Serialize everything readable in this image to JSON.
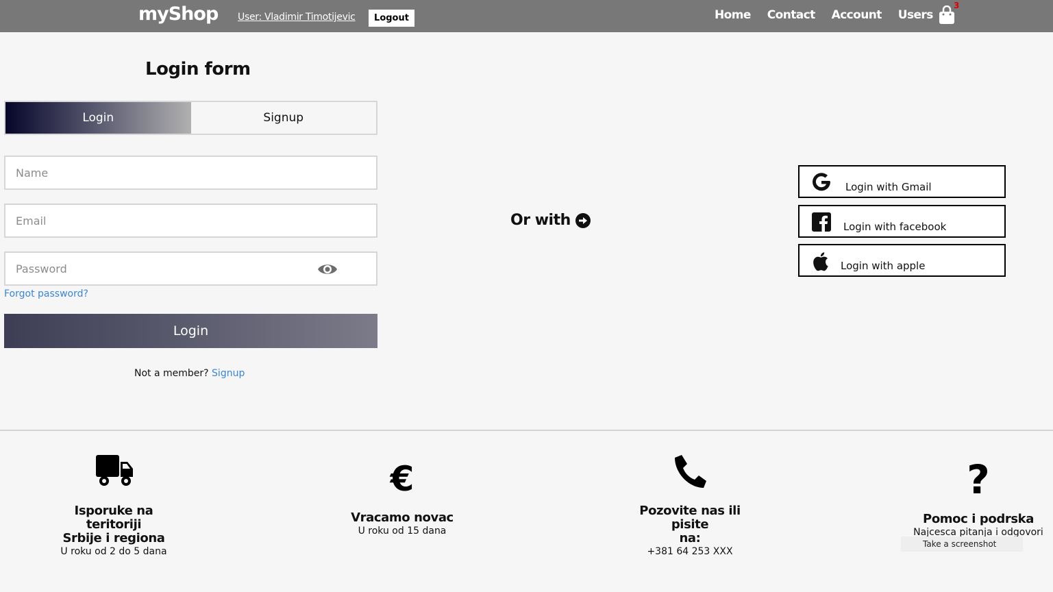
{
  "header": {
    "brand": "myShop",
    "user_link": "User: Vladimir Timotijevic",
    "logout_label": "Logout",
    "nav": [
      "Home",
      "Contact",
      "Account",
      "Users"
    ],
    "cart_count": "3",
    "cart_icon": "shopping-bag-icon"
  },
  "login_form": {
    "title": "Login form",
    "tabs": {
      "login": "Login",
      "signup": "Signup"
    },
    "name_placeholder": "Name",
    "email_placeholder": "Email",
    "password_placeholder": "Password",
    "password_toggle_icon": "eye-icon",
    "forgot": "Forgot password?",
    "submit_label": "Login",
    "not_member": "Not a member?",
    "signup_link": "Signup"
  },
  "or_with": "Or with",
  "social": {
    "gmail": "Login with Gmail",
    "facebook": "Login with facebook",
    "apple": "Login with apple"
  },
  "footer": {
    "features": [
      {
        "icon": "truck-icon",
        "title_line1": "Isporuke na teritoriji",
        "title_line2": "Srbije i regiona",
        "subtitle": "U roku od 2 do 5 dana"
      },
      {
        "icon": "euro-icon",
        "title_line1": "Vracamo novac",
        "title_line2": "",
        "subtitle": "U roku od 15 dana"
      },
      {
        "icon": "phone-icon",
        "title_line1": "Pozovite nas ili pisite",
        "title_line2": "na:",
        "subtitle": "+381 64 253 XXX"
      },
      {
        "icon": "question-icon",
        "title_line1": "Pomoc i podrska",
        "title_line2": "",
        "subtitle": "Najcesca pitanja i odgovori"
      }
    ]
  },
  "screenshot_tip": "Take a screenshot"
}
